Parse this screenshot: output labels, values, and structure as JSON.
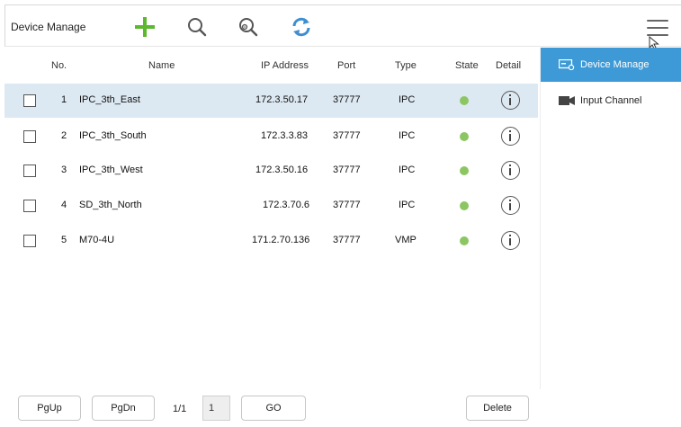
{
  "toolbar": {
    "title": "Device Manage",
    "icons": [
      "add-icon",
      "search-icon",
      "device-search-icon",
      "refresh-icon",
      "menu-icon"
    ],
    "add_color": "#5cb82e",
    "refresh_color": "#3e8ed0"
  },
  "table": {
    "headers": {
      "no": "No.",
      "name": "Name",
      "ip": "IP Address",
      "port": "Port",
      "type": "Type",
      "state": "State",
      "detail": "Detail"
    },
    "rows": [
      {
        "no": "1",
        "name": "IPC_3th_East",
        "ip": "172.3.50.17",
        "port": "37777",
        "type": "IPC",
        "state": "online",
        "selected": true
      },
      {
        "no": "2",
        "name": "IPC_3th_South",
        "ip": "172.3.3.83",
        "port": "37777",
        "type": "IPC",
        "state": "online",
        "selected": false
      },
      {
        "no": "3",
        "name": "IPC_3th_West",
        "ip": "172.3.50.16",
        "port": "37777",
        "type": "IPC",
        "state": "online",
        "selected": false
      },
      {
        "no": "4",
        "name": "SD_3th_North",
        "ip": "172.3.70.6",
        "port": "37777",
        "type": "IPC",
        "state": "online",
        "selected": false
      },
      {
        "no": "5",
        "name": "M70-4U",
        "ip": "171.2.70.136",
        "port": "37777",
        "type": "VMP",
        "state": "online",
        "selected": false
      }
    ],
    "state_color": "#8cc662",
    "selected_row_color": "#dde9f2"
  },
  "sidebar": {
    "items": [
      {
        "label": "Device Manage",
        "icon": "device-manage-icon",
        "active": true
      },
      {
        "label": "Input Channel",
        "icon": "camera-icon",
        "active": false
      }
    ],
    "active_color": "#3e9ad6"
  },
  "footer": {
    "pgup": "PgUp",
    "pgdn": "PgDn",
    "page_info": "1/1",
    "page_input": "1",
    "go": "GO",
    "delete": "Delete"
  }
}
